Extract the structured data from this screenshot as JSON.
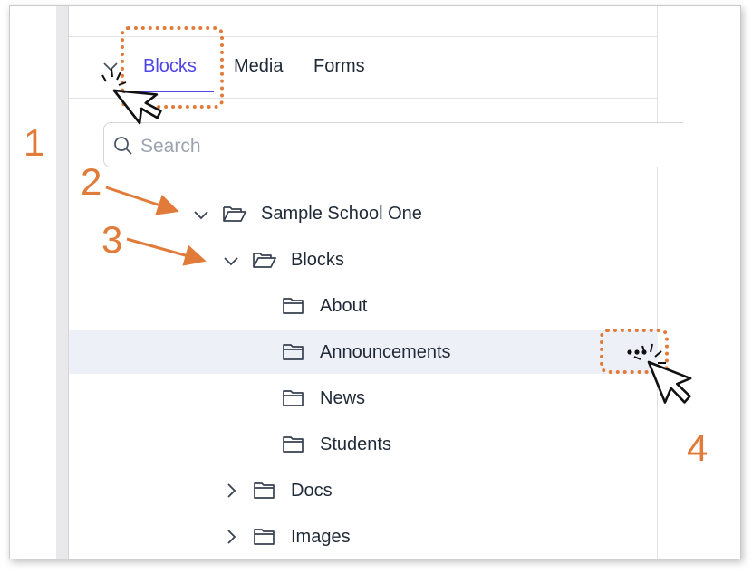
{
  "tabs": [
    {
      "label": "Blocks",
      "active": true
    },
    {
      "label": "Media",
      "active": false
    },
    {
      "label": "Forms",
      "active": false
    }
  ],
  "search": {
    "placeholder": "Search"
  },
  "tree": {
    "root": {
      "label": "Sample School One",
      "expanded": true
    },
    "blocks": {
      "label": "Blocks",
      "expanded": true
    },
    "children": [
      {
        "label": "About"
      },
      {
        "label": "Announcements",
        "highlighted": true
      },
      {
        "label": "News"
      },
      {
        "label": "Students"
      }
    ],
    "docs": {
      "label": "Docs",
      "expanded": false
    },
    "images": {
      "label": "Images",
      "expanded": false
    }
  },
  "more_button": {
    "label": "•••"
  },
  "annotations": {
    "step1": "1",
    "step2": "2",
    "step3": "3",
    "step4": "4"
  },
  "colors": {
    "accent": "#4f46e5",
    "annotation": "#e07b39",
    "highlight": "#eef0f8"
  }
}
